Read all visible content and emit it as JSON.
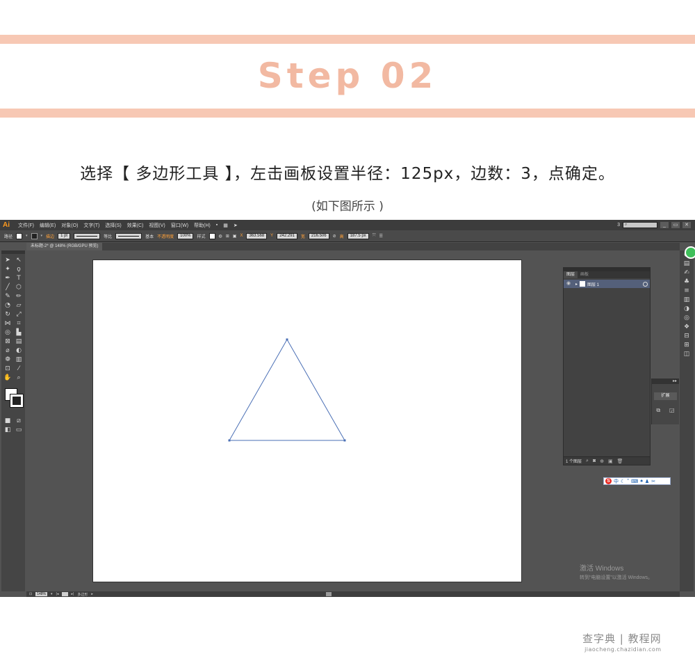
{
  "header": {
    "step_title": "Step 02",
    "instruction": "选择【 多边形工具 】，左击画板设置半径：125px，边数：3，点确定。",
    "subnote": "(如下图所示 )"
  },
  "app": {
    "logo": "Ai",
    "menu": [
      "文件(F)",
      "编辑(E)",
      "对象(O)",
      "文字(T)",
      "选择(S)",
      "效果(C)",
      "视图(V)",
      "窗口(W)",
      "帮助(H)"
    ],
    "workspace_number": "3",
    "window_buttons": [
      "_",
      "▭",
      "✕"
    ],
    "control_bar": {
      "selection_label": "路径",
      "stroke_label": "描边",
      "stroke_weight": "1 pt",
      "profile_label": "等比",
      "brush_label": "基本",
      "opacity_label": "不透明度",
      "opacity_value": "100%",
      "style_label": "样式",
      "x_label": "X",
      "x_value": "363.568",
      "y_label": "Y",
      "y_value": "242.291",
      "w_label": "宽",
      "w_value": "216.506",
      "h_label": "高",
      "h_value": "187.5 px"
    },
    "document_tab": "未标题-2* @ 148% (RGB/GPU 预览)",
    "layers_panel": {
      "tabs": [
        "图层",
        "画板"
      ],
      "layer_name": "图层 1",
      "footer_count": "1 个图层"
    },
    "collapsed_panel": {
      "expand_label": "扩展",
      "collapse_glyph": "▸▸"
    },
    "ime_bar": {
      "logo": "S",
      "mode": "中"
    },
    "windows_watermark": {
      "title": "激活 Windows",
      "subtitle": "转到“电脑设置”以激活 Windows。"
    },
    "status_bar": {
      "zoom": "148%",
      "tool_label": "多边形"
    }
  },
  "site_watermark": {
    "title": "查字典 | 教程网",
    "url": "jiaocheng.chazidian.com"
  },
  "colors": {
    "accent_stripe": "#f7c8b4",
    "step_title": "#f2b9a2",
    "path_stroke": "#4a6fb5",
    "panel_bg": "#535353"
  },
  "shape": {
    "tool": "polygon",
    "radius": "125px",
    "sides": 3
  }
}
